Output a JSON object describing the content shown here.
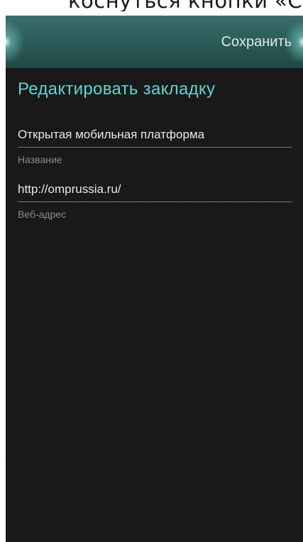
{
  "caption": {
    "text": "коснуться кнопки «Со"
  },
  "toolbar": {
    "save_label": "Сохранить"
  },
  "page": {
    "title": "Редактировать закладку"
  },
  "form": {
    "name": {
      "value": "Открытая мобильная платформа",
      "label": "Название"
    },
    "url": {
      "value": "http://omprussia.ru/",
      "label": "Веб-адрес"
    }
  },
  "colors": {
    "accent": "#5fd6cf",
    "header_teal": "#2b5b58",
    "background": "#161616"
  }
}
